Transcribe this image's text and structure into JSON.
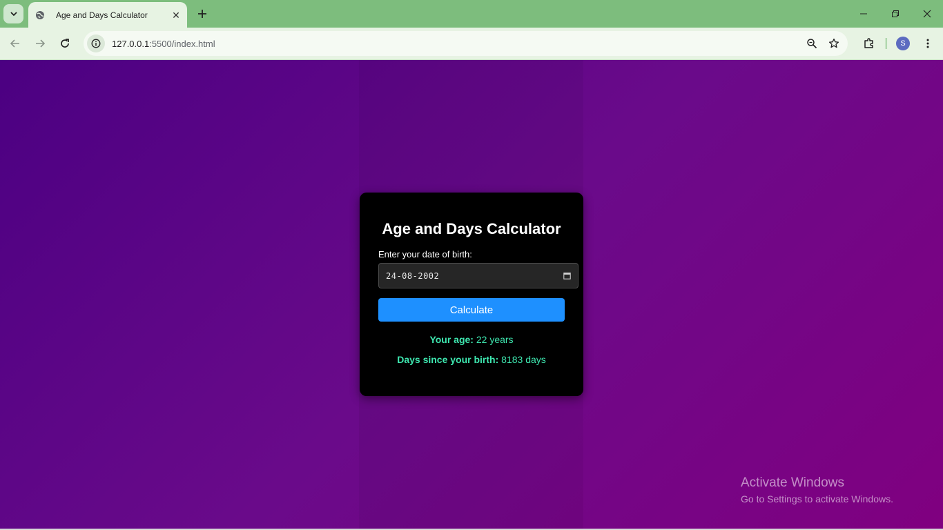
{
  "browser": {
    "tab": {
      "title": "Age and Days Calculator",
      "close_glyph": "✕"
    },
    "new_tab_glyph": "+",
    "url": {
      "host": "127.0.0.1",
      "path": ":5500/index.html"
    },
    "profile_initial": "S",
    "colors": {
      "chrome": "#7dbd7d",
      "toolbar": "#e7f3e3"
    }
  },
  "page": {
    "title": "Age and Days Calculator",
    "dob_label": "Enter your date of birth:",
    "dob_value": "24-08-2002",
    "calculate_label": "Calculate",
    "age_label": "Your age:",
    "age_value": "22 years",
    "days_label": "Days since your birth:",
    "days_value": "8183 days",
    "colors": {
      "button": "#1e90ff",
      "result_text": "#3ee8b0",
      "card": "#000000"
    }
  },
  "watermark": {
    "title": "Activate Windows",
    "subtitle": "Go to Settings to activate Windows."
  }
}
